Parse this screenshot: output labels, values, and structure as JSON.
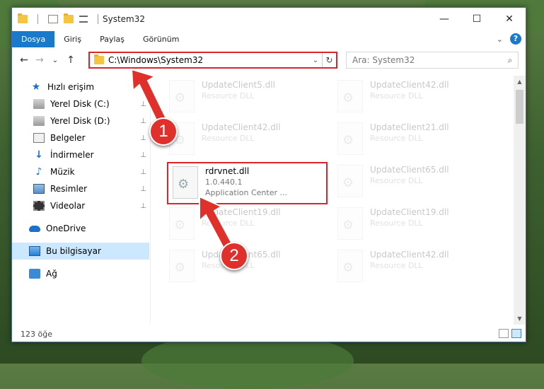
{
  "window": {
    "title": "System32",
    "controls": {
      "minimize": "—",
      "maximize": "☐",
      "close": "✕"
    }
  },
  "ribbon": {
    "tabs": [
      {
        "label": "Dosya",
        "active": true
      },
      {
        "label": "Giriş"
      },
      {
        "label": "Paylaş"
      },
      {
        "label": "Görünüm"
      }
    ]
  },
  "navbar": {
    "back": "←",
    "forward": "→",
    "recent": "⌄",
    "up": "↑",
    "address": "C:\\Windows\\System32",
    "dropdown": "⌄",
    "refresh": "↻",
    "search_placeholder": "Ara: System32",
    "search_icon": "⌕"
  },
  "sidebar": {
    "items": [
      {
        "label": "Hızlı erişim",
        "icon": "star-icon"
      },
      {
        "label": "Yerel Disk (C:)",
        "icon": "drive-icon",
        "pinned": true
      },
      {
        "label": "Yerel Disk (D:)",
        "icon": "drive-icon",
        "pinned": true
      },
      {
        "label": "Belgeler",
        "icon": "documents-icon",
        "pinned": true
      },
      {
        "label": "İndirmeler",
        "icon": "downloads-icon",
        "pinned": true
      },
      {
        "label": "Müzik",
        "icon": "music-icon",
        "pinned": true
      },
      {
        "label": "Resimler",
        "icon": "pictures-icon",
        "pinned": true
      },
      {
        "label": "Videolar",
        "icon": "videos-icon",
        "pinned": true
      },
      {
        "label": "OneDrive",
        "icon": "onedrive-icon"
      },
      {
        "label": "Bu bilgisayar",
        "icon": "pc-icon",
        "selected": true
      },
      {
        "label": "Ağ",
        "icon": "network-icon"
      }
    ],
    "pin_glyph": "📌"
  },
  "files": {
    "col1": [
      {
        "name": "UpdateClient5.dll",
        "sub": "Resource DLL"
      },
      {
        "name": "UpdateClient42.dll",
        "sub": "Resource DLL"
      },
      {
        "name": "rdrvnet.dll",
        "sub": "1.0.440.1",
        "sub2": "Application Center ...",
        "highlight": true
      },
      {
        "name": "UpdateClient19.dll",
        "sub": "Resource DLL"
      },
      {
        "name": "UpdateClient65.dll",
        "sub": "Resource DLL"
      }
    ],
    "col2": [
      {
        "name": "UpdateClient42.dll",
        "sub": "Resource DLL"
      },
      {
        "name": "UpdateClient21.dll",
        "sub": "Resource DLL"
      },
      {
        "name": "UpdateClient65.dll",
        "sub": "Resource DLL"
      },
      {
        "name": "UpdateClient19.dll",
        "sub": "Resource DLL"
      },
      {
        "name": "UpdateClient42.dll",
        "sub": "Resource DLL"
      }
    ]
  },
  "status": {
    "count": "123 öğe"
  },
  "annotations": {
    "step1": "1",
    "step2": "2",
    "arrow_color": "#e0302c"
  }
}
